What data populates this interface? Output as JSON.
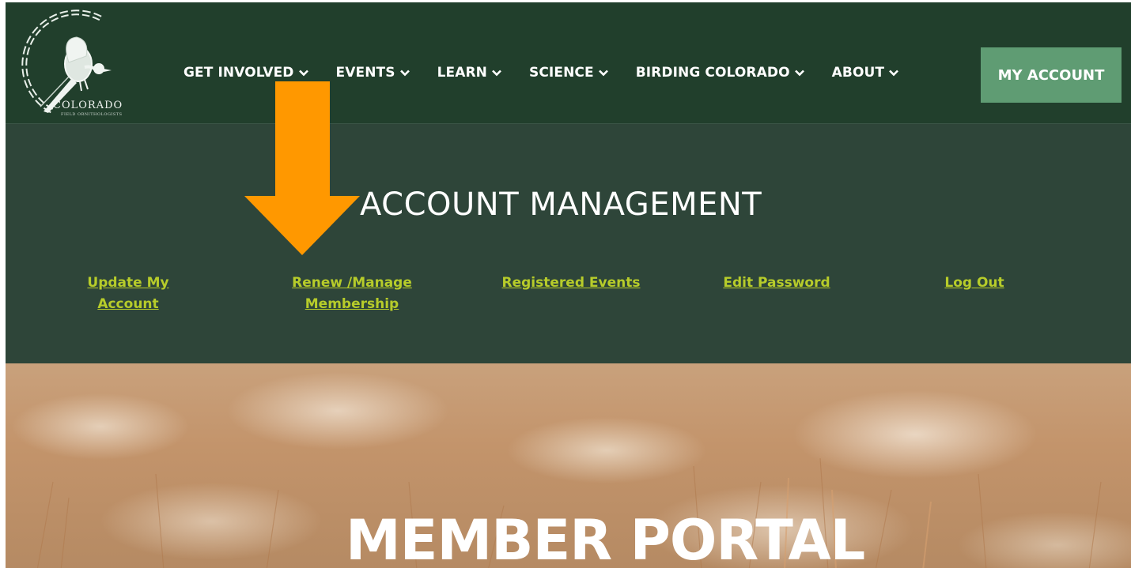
{
  "brand": {
    "logo_text": "COLORADO",
    "logo_subtext": "FIELD ORNITHOLOGISTS"
  },
  "nav": {
    "items": [
      {
        "label": "GET INVOLVED"
      },
      {
        "label": "EVENTS"
      },
      {
        "label": "LEARN"
      },
      {
        "label": "SCIENCE"
      },
      {
        "label": "BIRDING COLORADO"
      },
      {
        "label": "ABOUT"
      }
    ],
    "my_account": "MY ACCOUNT"
  },
  "account": {
    "title": "ACCOUNT MANAGEMENT",
    "links": [
      {
        "label": "Update My Account"
      },
      {
        "label": "Renew /Manage Membership"
      },
      {
        "label": "Registered Events"
      },
      {
        "label": "Edit Password"
      },
      {
        "label": "Log Out"
      }
    ]
  },
  "hero": {
    "title": "MEMBER PORTAL"
  },
  "colors": {
    "header_bg": "#213f2c",
    "band_bg": "#2e4539",
    "account_button": "#5f9c73",
    "link_color": "#b7cc2a",
    "arrow": "#ff9800"
  },
  "icons": {
    "nav_chevron": "chevron-down-icon",
    "annotation_arrow": "down-arrow-icon"
  }
}
